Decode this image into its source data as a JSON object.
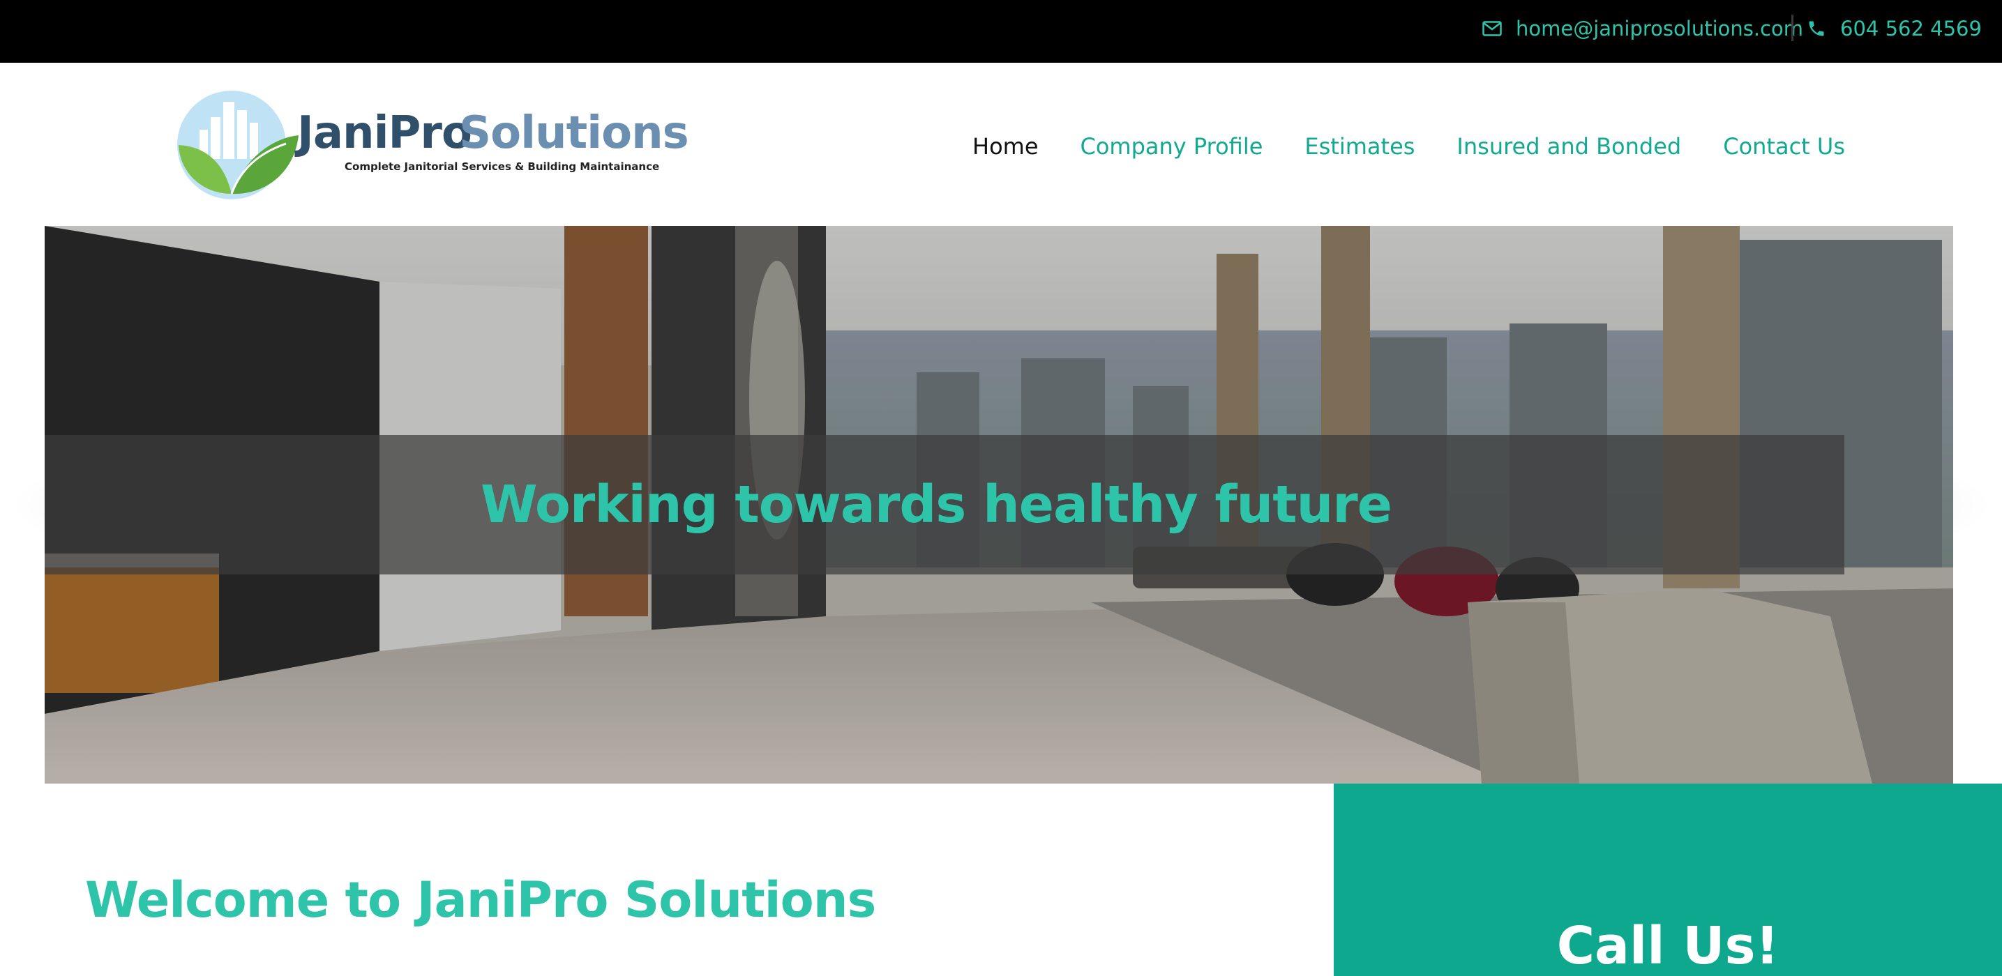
{
  "topbar": {
    "email": "home@janiprosolutions.com",
    "phone": "604 562 4569",
    "email_icon": "envelope-icon",
    "phone_icon": "phone-icon"
  },
  "logo": {
    "name_part1": "JaniPro",
    "name_part2": "Solutions",
    "tagline": "Complete Janitorial Services & Building Maintainance"
  },
  "nav": {
    "items": [
      {
        "label": "Home",
        "active": true
      },
      {
        "label": "Company Profile",
        "active": false
      },
      {
        "label": "Estimates",
        "active": false
      },
      {
        "label": "Insured and Bonded",
        "active": false
      },
      {
        "label": "Contact Us",
        "active": false
      }
    ]
  },
  "hero": {
    "headline": "Working towards healthy future"
  },
  "welcome": {
    "title": "Welcome to JaniPro Solutions"
  },
  "call": {
    "title": "Call Us!"
  },
  "colors": {
    "accent": "#2ec4aa",
    "nav_link": "#12a991",
    "call_panel": "#0da88e",
    "topbar": "#000000"
  }
}
